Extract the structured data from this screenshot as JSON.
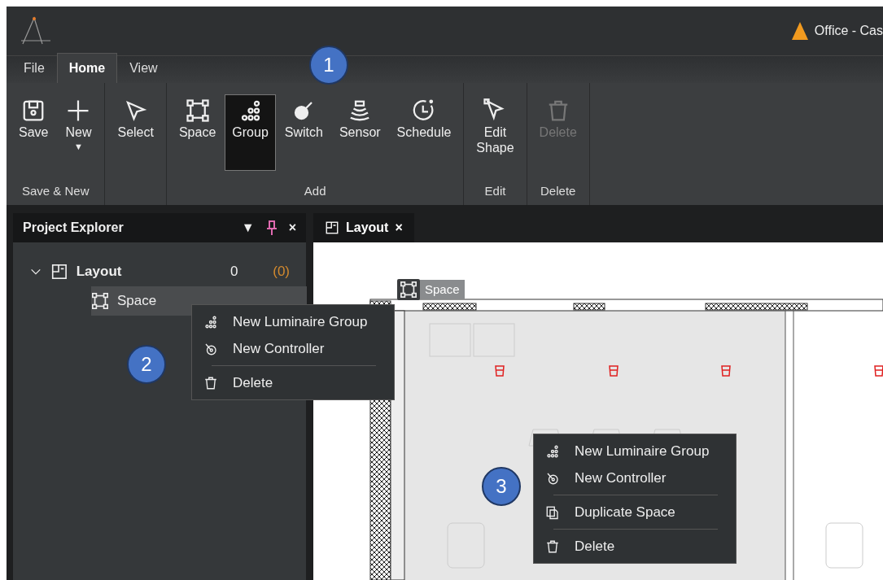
{
  "title_bar": {
    "title": "Office - Cas"
  },
  "ribbon_tabs": [
    {
      "label": "File",
      "selected": false
    },
    {
      "label": "Home",
      "selected": true
    },
    {
      "label": "View",
      "selected": false
    }
  ],
  "ribbon_groups": [
    {
      "label": "Save & New",
      "buttons": [
        {
          "label": "Save",
          "kind": "save",
          "selected": false,
          "disabled": false
        },
        {
          "label": "New",
          "kind": "new",
          "caret": "▼",
          "selected": false,
          "disabled": false
        }
      ]
    },
    {
      "buttons": [
        {
          "label": "Select",
          "kind": "select",
          "selected": false,
          "disabled": false
        }
      ]
    },
    {
      "label": "Add",
      "buttons": [
        {
          "label": "Space",
          "kind": "space",
          "selected": false,
          "disabled": false
        },
        {
          "label": "Group",
          "kind": "group",
          "selected": true,
          "disabled": false
        },
        {
          "label": "Switch",
          "kind": "switch",
          "selected": false,
          "disabled": false
        },
        {
          "label": "Sensor",
          "kind": "sensor",
          "selected": false,
          "disabled": false
        },
        {
          "label": "Schedule",
          "kind": "schedule",
          "selected": false,
          "disabled": false
        }
      ]
    },
    {
      "label": "Edit",
      "buttons": [
        {
          "label": "Edit Shape",
          "kind": "edit",
          "selected": false,
          "disabled": false
        }
      ]
    },
    {
      "label": "Delete",
      "buttons": [
        {
          "label": "Delete",
          "kind": "delete",
          "selected": false,
          "disabled": true
        }
      ]
    }
  ],
  "project_explorer": {
    "title": "Project Explorer",
    "menu": "▼",
    "close": "×",
    "tree": [
      {
        "label": "Layout",
        "kind": "layout",
        "count": "0",
        "pending": "(0)",
        "expanded": true,
        "selected": false,
        "children": [
          {
            "label": "Space",
            "kind": "space",
            "selected": true
          }
        ]
      }
    ]
  },
  "document_tab": {
    "label": "Layout",
    "close": "×"
  },
  "canvas": {
    "space_tag": "Space"
  },
  "context_menus": [
    {
      "items": [
        {
          "kind": "group",
          "label": "New Luminaire Group"
        },
        {
          "kind": "controller",
          "label": "New Controller"
        },
        {
          "kind": "divider"
        },
        {
          "kind": "delete",
          "label": "Delete"
        }
      ]
    },
    {
      "items": [
        {
          "kind": "group",
          "label": "New Luminaire Group"
        },
        {
          "kind": "controller",
          "label": "New Controller"
        },
        {
          "kind": "divider"
        },
        {
          "kind": "duplicate",
          "label": "Duplicate Space"
        },
        {
          "kind": "divider"
        },
        {
          "kind": "delete",
          "label": "Delete"
        }
      ]
    }
  ],
  "callouts": [
    "1",
    "2",
    "3"
  ]
}
